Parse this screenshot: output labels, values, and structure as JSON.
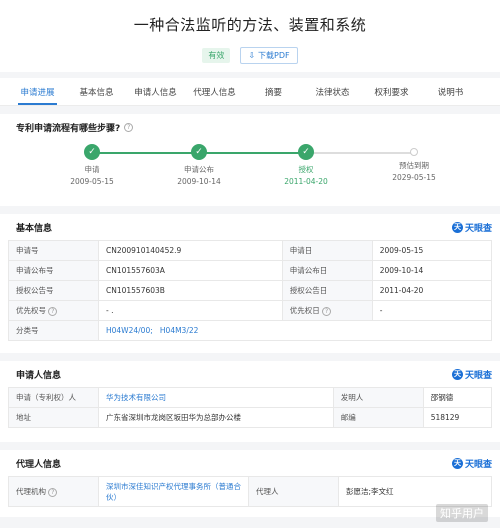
{
  "header": {
    "title": "一种合法监听的方法、装置和系统",
    "status": "有效",
    "pdf_button": "下载PDF"
  },
  "tabs": [
    "申请进展",
    "基本信息",
    "申请人信息",
    "代理人信息",
    "摘要",
    "法律状态",
    "权利要求",
    "说明书"
  ],
  "process": {
    "title": "专利申请流程有哪些步骤?",
    "steps": [
      {
        "label": "申请",
        "date": "2009-05-15"
      },
      {
        "label": "申请公布",
        "date": "2009-10-14"
      },
      {
        "label": "授权",
        "date": "2011-04-20"
      },
      {
        "label": "预估到期",
        "date": "2029-05-15"
      }
    ]
  },
  "brand": "天眼查",
  "basic": {
    "title": "基本信息",
    "rows": [
      {
        "k1": "申请号",
        "v1": "CN200910140452.9",
        "k2": "申请日",
        "v2": "2009-05-15"
      },
      {
        "k1": "申请公布号",
        "v1": "CN101557603A",
        "k2": "申请公布日",
        "v2": "2009-10-14"
      },
      {
        "k1": "授权公告号",
        "v1": "CN101557603B",
        "k2": "授权公告日",
        "v2": "2011-04-20"
      },
      {
        "k1": "优先权号",
        "v1": "- .",
        "k2": "优先权日",
        "v2": "-"
      }
    ],
    "class_label": "分类号",
    "class_codes": [
      "H04W24/00;",
      "H04M3/22"
    ]
  },
  "applicant": {
    "title": "申请人信息",
    "rows": [
      {
        "k1": "申请（专利权）人",
        "v1": "华为技术有限公司",
        "k2": "发明人",
        "v2": "邵钢德"
      },
      {
        "k1": "地址",
        "v1": "广东省深圳市龙岗区坂田华为总部办公楼",
        "k2": "邮编",
        "v2": "518129"
      }
    ]
  },
  "agent": {
    "title": "代理人信息",
    "rows": [
      {
        "k1": "代理机构",
        "v1": "深圳市深佳知识产权代理事务所（普通合伙）",
        "k2": "代理人",
        "v2": "彭愿洁;李文红"
      }
    ]
  },
  "watermark": "知乎用户"
}
